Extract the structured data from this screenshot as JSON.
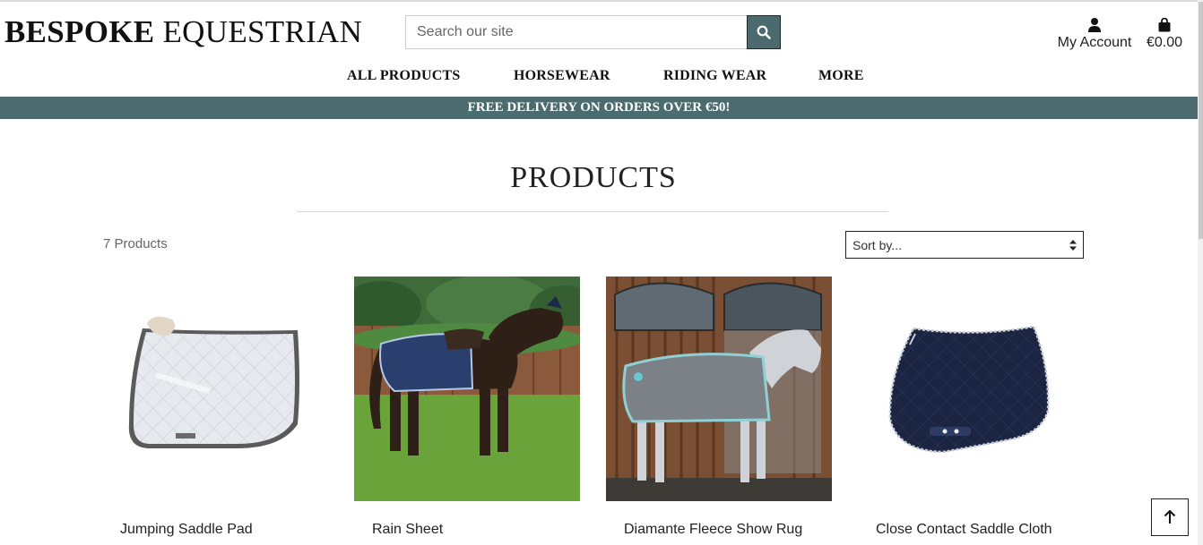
{
  "brand": {
    "bold": "BESPOKE",
    "rest": " EQUESTRIAN"
  },
  "search": {
    "placeholder": "Search our site"
  },
  "account": {
    "label": "My Account"
  },
  "bag": {
    "total": "€0.00"
  },
  "nav": {
    "items": [
      "ALL PRODUCTS",
      "HORSEWEAR",
      "RIDING WEAR",
      "MORE"
    ]
  },
  "banner": {
    "text": "FREE DELIVERY ON ORDERS OVER €50!"
  },
  "page": {
    "title": "PRODUCTS",
    "count": "7 Products"
  },
  "sort": {
    "selected": "Sort by..."
  },
  "products": [
    {
      "name": "Jumping Saddle Pad"
    },
    {
      "name": "Rain Sheet"
    },
    {
      "name": "Diamante Fleece Show Rug"
    },
    {
      "name": "Close Contact Saddle Cloth"
    }
  ],
  "colors": {
    "accent": "#4c6b6e",
    "text": "#222222"
  },
  "icons": [
    "search-icon",
    "user-icon",
    "shopping-bag-icon",
    "sort-arrows-icon",
    "arrow-up-icon"
  ]
}
